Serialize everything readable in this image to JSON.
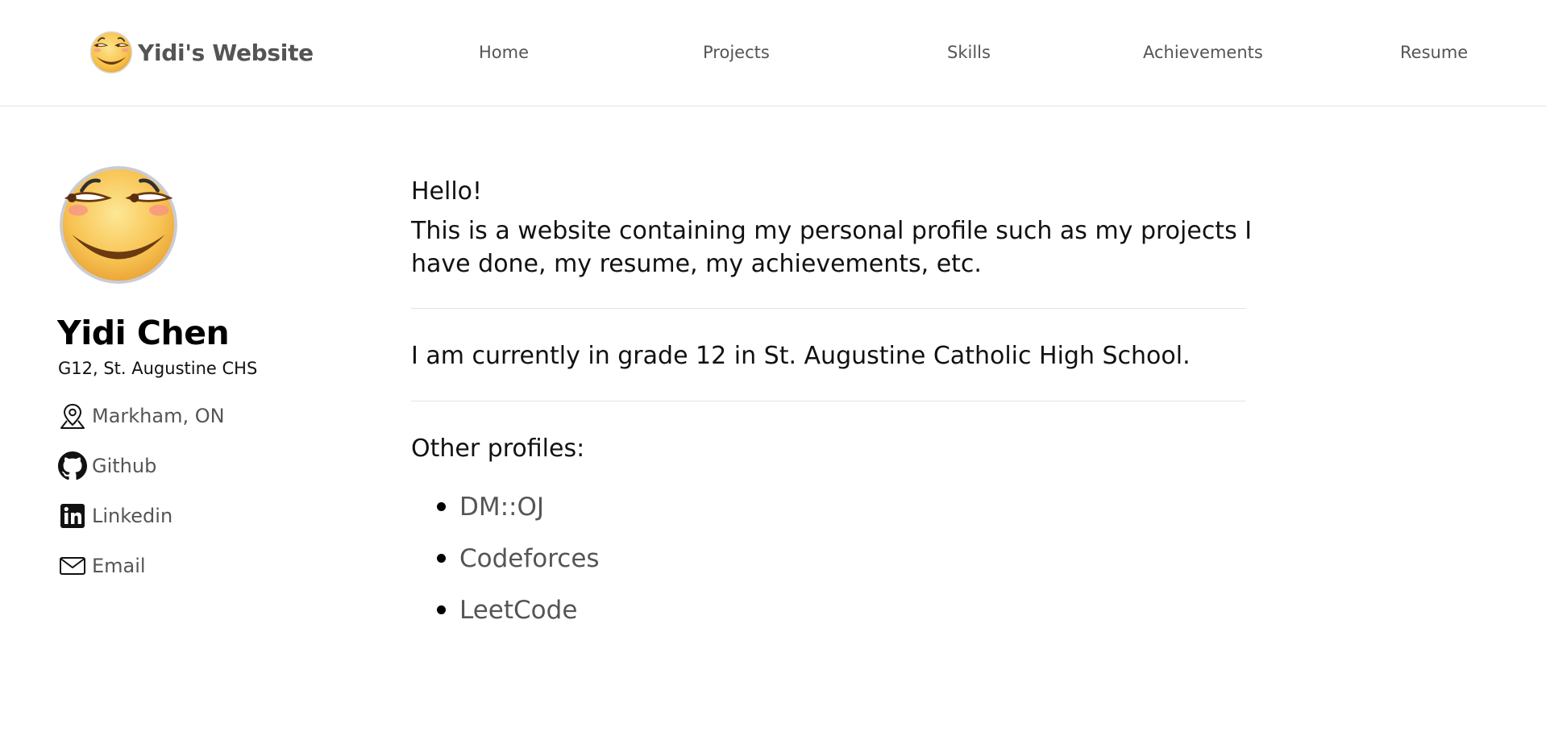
{
  "header": {
    "brand_title": "Yidi's Website",
    "nav": [
      {
        "label": "Home"
      },
      {
        "label": "Projects"
      },
      {
        "label": "Skills"
      },
      {
        "label": "Achievements"
      },
      {
        "label": "Resume"
      }
    ]
  },
  "sidebar": {
    "name": "Yidi Chen",
    "subtitle": "G12, St. Augustine CHS",
    "location": {
      "icon": "map-pin-icon",
      "label": "Markham, ON"
    },
    "links": [
      {
        "icon": "github-icon",
        "label": "Github"
      },
      {
        "icon": "linkedin-icon",
        "label": "Linkedin"
      },
      {
        "icon": "email-icon",
        "label": "Email"
      }
    ]
  },
  "main": {
    "greeting": "Hello!",
    "intro": "This is a website containing my personal profile such as my projects I have done, my resume, my achievements, etc.",
    "grade": "I am currently in grade 12 in St. Augustine Catholic High School.",
    "profiles_heading": "Other profiles:",
    "profiles": [
      {
        "label": "DM::OJ"
      },
      {
        "label": "Codeforces"
      },
      {
        "label": "LeetCode"
      }
    ]
  },
  "colors": {
    "link_gray": "#555555",
    "divider": "#e3e3e3",
    "emoji_yellow": "#f7c24a"
  }
}
